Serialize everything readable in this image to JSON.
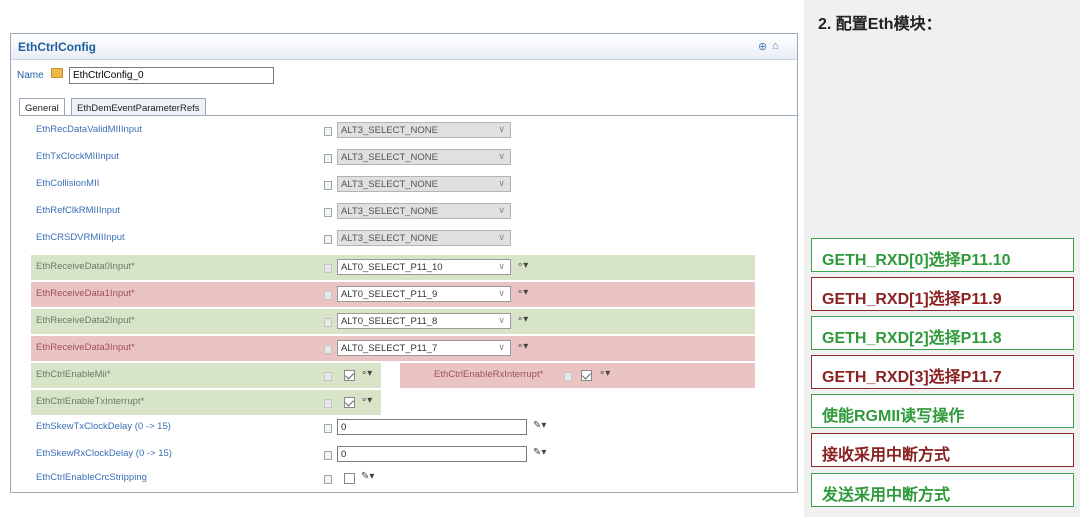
{
  "window": {
    "title": "EthCtrlConfig",
    "name_label": "Name",
    "name_value": "EthCtrlConfig_0",
    "tabs": [
      "General",
      "EthDemEventParameterRefs"
    ]
  },
  "rows": [
    {
      "label": "EthRecDataValidMIIInput",
      "value": "ALT3_SELECT_NONE"
    },
    {
      "label": "EthTxClockMIIInput",
      "value": "ALT3_SELECT_NONE"
    },
    {
      "label": "EthCollisionMII",
      "value": "ALT3_SELECT_NONE"
    },
    {
      "label": "EthRefClkRMIIInput",
      "value": "ALT3_SELECT_NONE"
    },
    {
      "label": "EthCRSDVRMIIInput",
      "value": "ALT3_SELECT_NONE"
    },
    {
      "label": "EthReceiveData0Input*",
      "value": "ALT0_SELECT_P11_10"
    },
    {
      "label": "EthReceiveData1Input*",
      "value": "ALT0_SELECT_P11_9"
    },
    {
      "label": "EthReceiveData2Input*",
      "value": "ALT0_SELECT_P11_8"
    },
    {
      "label": "EthReceiveData3Input*",
      "value": "ALT0_SELECT_P11_7"
    },
    {
      "label": "EthCtrlEnableMii*",
      "value": ""
    },
    {
      "label": "EthCtrlEnableTxInterrupt*",
      "value": ""
    },
    {
      "label": "EthSkewTxClockDelay (0 -> 15)",
      "value": "0"
    },
    {
      "label": "EthSkewRxClockDelay (0 -> 15)",
      "value": "0"
    },
    {
      "label": "EthCtrlEnableCrcStripping",
      "value": ""
    }
  ],
  "rx_interrupt_label": "EthCtrlEnableRxInterrupt*",
  "colors": {
    "green": "#d8e4c8",
    "red": "#e9c4c3",
    "note_green": "#2f9a3a",
    "note_red": "#8a2222"
  },
  "panel": {
    "step": "2.  配置Eth模块：",
    "notes": [
      {
        "text": "GETH_RXD[0]选择P11.10",
        "color": "green"
      },
      {
        "text": "GETH_RXD[1]选择P11.9",
        "color": "red"
      },
      {
        "text": "GETH_RXD[2]选择P11.8",
        "color": "green"
      },
      {
        "text": "GETH_RXD[3]选择P11.7",
        "color": "red"
      },
      {
        "text": "使能RGMII读写操作",
        "color": "green"
      },
      {
        "text": "接收采用中断方式",
        "color": "red"
      },
      {
        "text": "发送采用中断方式",
        "color": "green"
      }
    ]
  }
}
